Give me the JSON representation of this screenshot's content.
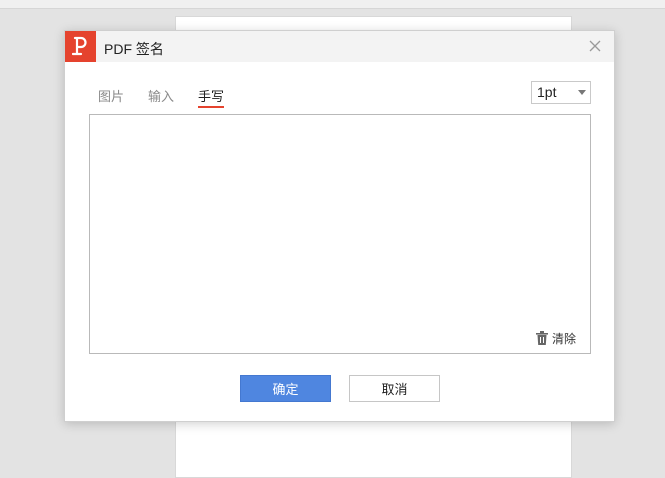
{
  "dialog": {
    "title": "PDF 签名",
    "tabs": [
      {
        "label": "图片",
        "active": false
      },
      {
        "label": "输入",
        "active": false
      },
      {
        "label": "手写",
        "active": true
      }
    ],
    "pen_size": "1pt",
    "clear_label": "清除",
    "confirm_label": "确定",
    "cancel_label": "取消"
  },
  "colors": {
    "accent": "#e5432e",
    "primary_button": "#4f86e0"
  },
  "icons": [
    "pdf-logo-icon",
    "close-icon",
    "trash-icon",
    "chevron-down-icon"
  ]
}
